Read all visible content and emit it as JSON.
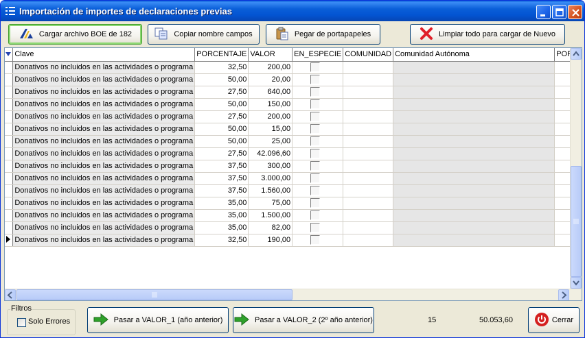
{
  "window": {
    "title": "Importación de importes de declaraciones previas",
    "icon": "list-icon"
  },
  "toolbar": {
    "load_boe": "Cargar archivo BOE de 182",
    "copy_fields": "Copiar nombre campos",
    "paste": "Pegar de portapapeles",
    "clear_all": "Limpiar todo para cargar de Nuevo"
  },
  "grid": {
    "columns": {
      "clave": "Clave",
      "porcentaje": "PORCENTAJE",
      "valor": "VALOR",
      "en_especie": "EN_ESPECIE",
      "comunidad": "COMUNIDAD",
      "comunidad_autonoma": "Comunidad Autónoma",
      "por": "POR"
    },
    "rows": [
      {
        "clave": "Donativos no incluidos en las actividades o programa",
        "porcentaje": "32,50",
        "valor": "200,00"
      },
      {
        "clave": "Donativos no incluidos en las actividades o programa",
        "porcentaje": "50,00",
        "valor": "20,00"
      },
      {
        "clave": "Donativos no incluidos en las actividades o programa",
        "porcentaje": "27,50",
        "valor": "640,00"
      },
      {
        "clave": "Donativos no incluidos en las actividades o programa",
        "porcentaje": "50,00",
        "valor": "150,00"
      },
      {
        "clave": "Donativos no incluidos en las actividades o programa",
        "porcentaje": "27,50",
        "valor": "200,00"
      },
      {
        "clave": "Donativos no incluidos en las actividades o programa",
        "porcentaje": "50,00",
        "valor": "15,00"
      },
      {
        "clave": "Donativos no incluidos en las actividades o programa",
        "porcentaje": "50,00",
        "valor": "25,00"
      },
      {
        "clave": "Donativos no incluidos en las actividades o programa",
        "porcentaje": "27,50",
        "valor": "42.096,60"
      },
      {
        "clave": "Donativos no incluidos en las actividades o programa",
        "porcentaje": "37,50",
        "valor": "300,00"
      },
      {
        "clave": "Donativos no incluidos en las actividades o programa",
        "porcentaje": "37,50",
        "valor": "3.000,00"
      },
      {
        "clave": "Donativos no incluidos en las actividades o programa",
        "porcentaje": "37,50",
        "valor": "1.560,00"
      },
      {
        "clave": "Donativos no incluidos en las actividades o programa",
        "porcentaje": "35,00",
        "valor": "75,00"
      },
      {
        "clave": "Donativos no incluidos en las actividades o programa",
        "porcentaje": "35,00",
        "valor": "1.500,00"
      },
      {
        "clave": "Donativos no incluidos en las actividades o programa",
        "porcentaje": "35,00",
        "valor": "82,00"
      },
      {
        "clave": "Donativos no incluidos en las actividades o programa",
        "porcentaje": "32,50",
        "valor": "190,00"
      }
    ]
  },
  "filters": {
    "label": "Filtros",
    "only_errors": "Solo Errores"
  },
  "actions": {
    "pass_valor1": "Pasar a VALOR_1 (año anterior)",
    "pass_valor2": "Pasar a VALOR_2 (2º año anterior)",
    "close": "Cerrar"
  },
  "summary": {
    "count": "15",
    "total": "50.053,60"
  },
  "colors": {
    "titlebar": "#0a5fd8",
    "window_bg": "#ece9d8",
    "arrow_green": "#2ea02a",
    "clear_red": "#e0202a"
  }
}
